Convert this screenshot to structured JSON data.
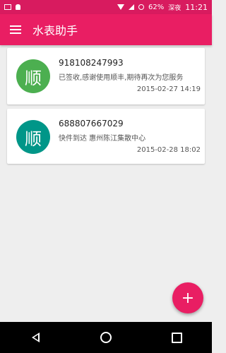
{
  "status_bar": {
    "left_icons": [
      "image-icon",
      "android-icon"
    ],
    "battery": "62%",
    "carrier": "深夜",
    "time": "11:21"
  },
  "app_bar": {
    "menu_icon": "hamburger-menu-icon",
    "title": "水表助手"
  },
  "cards": [
    {
      "avatar_text": "顺",
      "avatar_color": "#4caf50",
      "tracking_number": "918108247993",
      "status": "已签收,感谢使用顺丰,期待再次为您服务",
      "time": "2015-02-27 14:19"
    },
    {
      "avatar_text": "顺",
      "avatar_color": "#009688",
      "tracking_number": "688807667029",
      "status": "快件到达 惠州陈江集散中心",
      "time": "2015-02-28 18:02"
    }
  ],
  "fab": {
    "label": "+"
  },
  "colors": {
    "primary": "#e91e63",
    "status_bar": "#d81b5f",
    "background": "#eeeeee"
  }
}
